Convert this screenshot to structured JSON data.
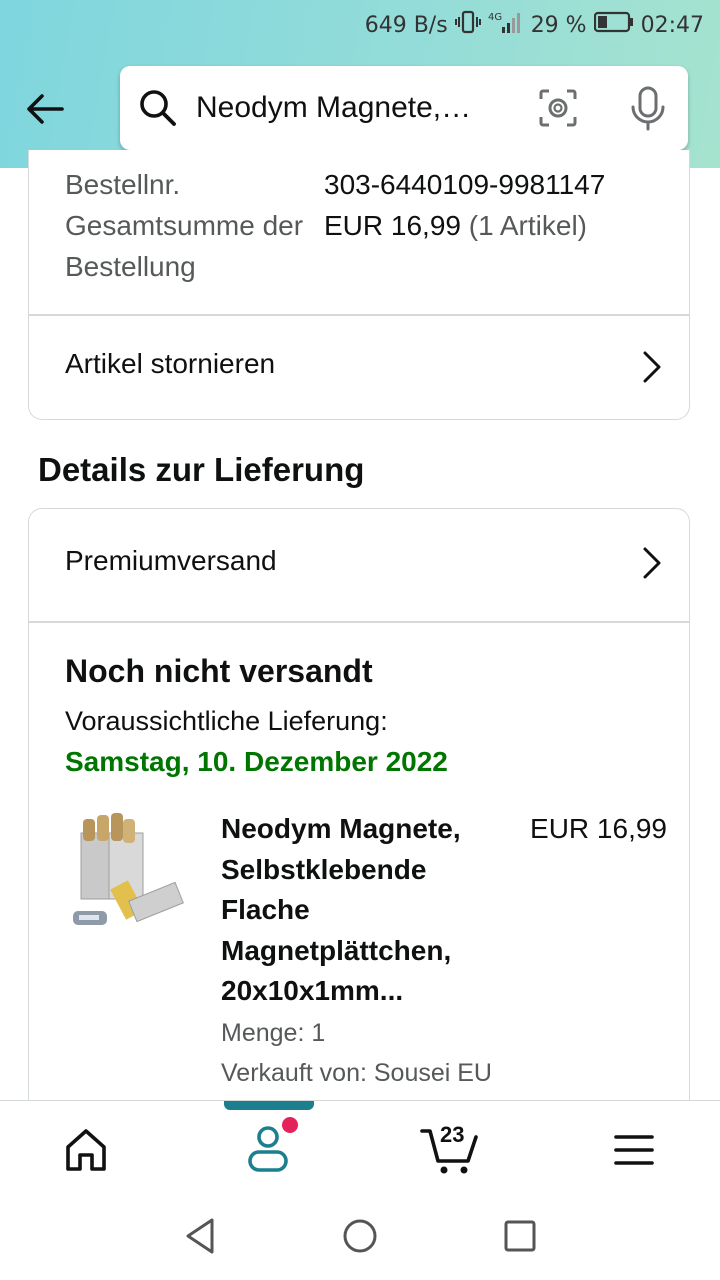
{
  "status_bar": {
    "speed": "649 B/s",
    "network": "4G",
    "battery": "29 %",
    "time": "02:47"
  },
  "search": {
    "query": "Neodym Magnete,…"
  },
  "order_summary": {
    "order_no_label": "Bestellnr.",
    "order_no_value": "303-6440109-9981147",
    "total_label": "Gesamtsumme der Bestellung",
    "total_value": "EUR 16,99",
    "total_items": "(1 Artikel)",
    "cancel_label": "Artikel stornieren"
  },
  "delivery": {
    "heading": "Details zur Lieferung",
    "shipping_method": "Premiumversand",
    "status": "Noch nicht versandt",
    "eta_label": "Voraussichtliche Lieferung:",
    "eta_date": "Samstag, 10. Dezember 2022",
    "product": {
      "title_lines": [
        "Neodym Magnete,",
        "Selbstklebende",
        "Flache",
        "Magnetplättchen,",
        "20x10x1mm..."
      ],
      "price": "EUR 16,99",
      "quantity": "Menge: 1",
      "seller": "Verkauft von: Sousei EU"
    }
  },
  "bottom_nav": {
    "cart_count": "23",
    "active_tab": "account",
    "accent_color": "#1c7f8f",
    "notification_color": "#e4235b"
  },
  "colors": {
    "delivery_date": "#007600"
  }
}
